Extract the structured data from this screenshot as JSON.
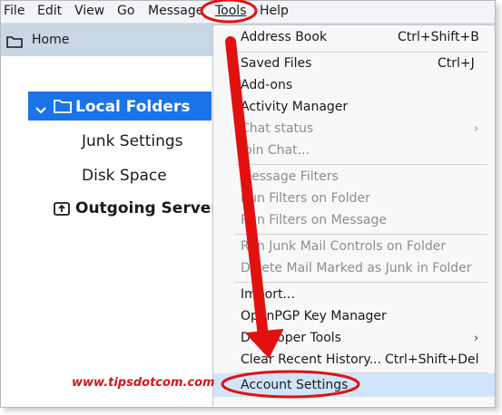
{
  "menubar": {
    "items": [
      {
        "label": "File",
        "id": "file"
      },
      {
        "label": "Edit",
        "id": "edit"
      },
      {
        "label": "View",
        "id": "view"
      },
      {
        "label": "Go",
        "id": "go"
      },
      {
        "label": "Message",
        "id": "message"
      },
      {
        "label": "Tools",
        "id": "tools"
      },
      {
        "label": "Help",
        "id": "help"
      }
    ]
  },
  "tab": {
    "label": "Home",
    "icon": "folder-icon"
  },
  "tree": {
    "selected": "Local Folders",
    "items": [
      "Junk Settings",
      "Disk Space"
    ],
    "outgoing": "Outgoing Server"
  },
  "tools_menu": {
    "items": [
      {
        "label": "Address Book",
        "shortcut": "Ctrl+Shift+B",
        "enabled": true
      },
      {
        "label": "Saved Files",
        "shortcut": "Ctrl+J",
        "enabled": true
      },
      {
        "label": "Add-ons",
        "enabled": true
      },
      {
        "label": "Activity Manager",
        "enabled": true
      },
      {
        "label": "Chat status",
        "enabled": false,
        "submenu": true
      },
      {
        "label": "Join Chat...",
        "enabled": false
      },
      {
        "label": "Message Filters",
        "enabled": false
      },
      {
        "label": "Run Filters on Folder",
        "enabled": false
      },
      {
        "label": "Run Filters on Message",
        "enabled": false
      },
      {
        "label": "Run Junk Mail Controls on Folder",
        "enabled": false
      },
      {
        "label": "Delete Mail Marked as Junk in Folder",
        "enabled": false
      },
      {
        "label": "Import...",
        "enabled": true
      },
      {
        "label": "OpenPGP Key Manager",
        "enabled": true
      },
      {
        "label": "Developer Tools",
        "enabled": true,
        "submenu": true
      },
      {
        "label": "Clear Recent History...",
        "shortcut": "Ctrl+Shift+Del",
        "enabled": true
      },
      {
        "label": "Account Settings",
        "enabled": true,
        "highlighted": true
      }
    ]
  },
  "watermark": "www.tipsdotcom.com",
  "colors": {
    "accent": "#1a73e8",
    "annotation_red": "#e31010",
    "menu_highlight": "#d0e5fb",
    "tabbar": "#c9d6e3"
  }
}
